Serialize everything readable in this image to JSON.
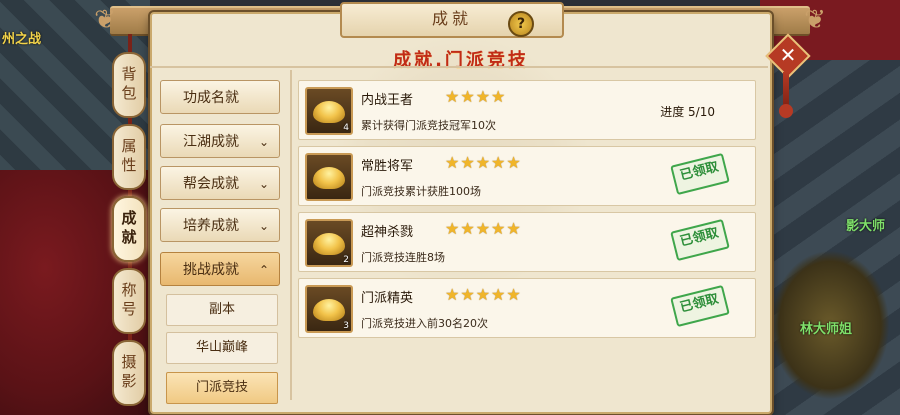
{
  "window": {
    "title": "成就",
    "help_label": "?",
    "close_label": "✕",
    "section_title": "成就.门派竞技"
  },
  "side_tabs": [
    {
      "label": "背包",
      "active": false
    },
    {
      "label": "属性",
      "active": false
    },
    {
      "label": "成就",
      "active": true
    },
    {
      "label": "称号",
      "active": false
    },
    {
      "label": "摄影",
      "active": false
    }
  ],
  "menu": {
    "items": [
      {
        "label": "功成名就",
        "chevron": ""
      },
      {
        "label": "江湖成就",
        "chevron": "⌄"
      },
      {
        "label": "帮会成就",
        "chevron": "⌄"
      },
      {
        "label": "培养成就",
        "chevron": "⌄"
      },
      {
        "label": "挑战成就",
        "chevron": "⌃"
      }
    ],
    "subitems": [
      {
        "label": "副本",
        "active": false
      },
      {
        "label": "华山巅峰",
        "active": false
      },
      {
        "label": "门派竞技",
        "active": true
      }
    ]
  },
  "achievements": [
    {
      "name": "内战王者",
      "stars": "★★★★",
      "star_count": 4,
      "desc": "累计获得门派竞技冠军10次",
      "icon_count": "4",
      "progress": "进度 5/10",
      "stamp": ""
    },
    {
      "name": "常胜将军",
      "stars": "★★★★★",
      "star_count": 5,
      "desc": "门派竞技累计获胜100场",
      "icon_count": "",
      "progress": "",
      "stamp": "已领取"
    },
    {
      "name": "超神杀戮",
      "stars": "★★★★★",
      "star_count": 5,
      "desc": "门派竞技连胜8场",
      "icon_count": "2",
      "progress": "",
      "stamp": "已领取"
    },
    {
      "name": "门派精英",
      "stars": "★★★★★",
      "star_count": 5,
      "desc": "门派竞技进入前30名20次",
      "icon_count": "3",
      "progress": "",
      "stamp": "已领取"
    }
  ],
  "scene_texts": [
    {
      "text": "州之战",
      "color": "#f2d34a"
    },
    {
      "text": "影大师",
      "color": "#7fe06a"
    },
    {
      "text": "林大师姐",
      "color": "#7fe06a"
    }
  ],
  "colors": {
    "accent_red": "#c12b16",
    "stamp_green": "#2e8f3a",
    "star_gold": "#f0b52a"
  }
}
